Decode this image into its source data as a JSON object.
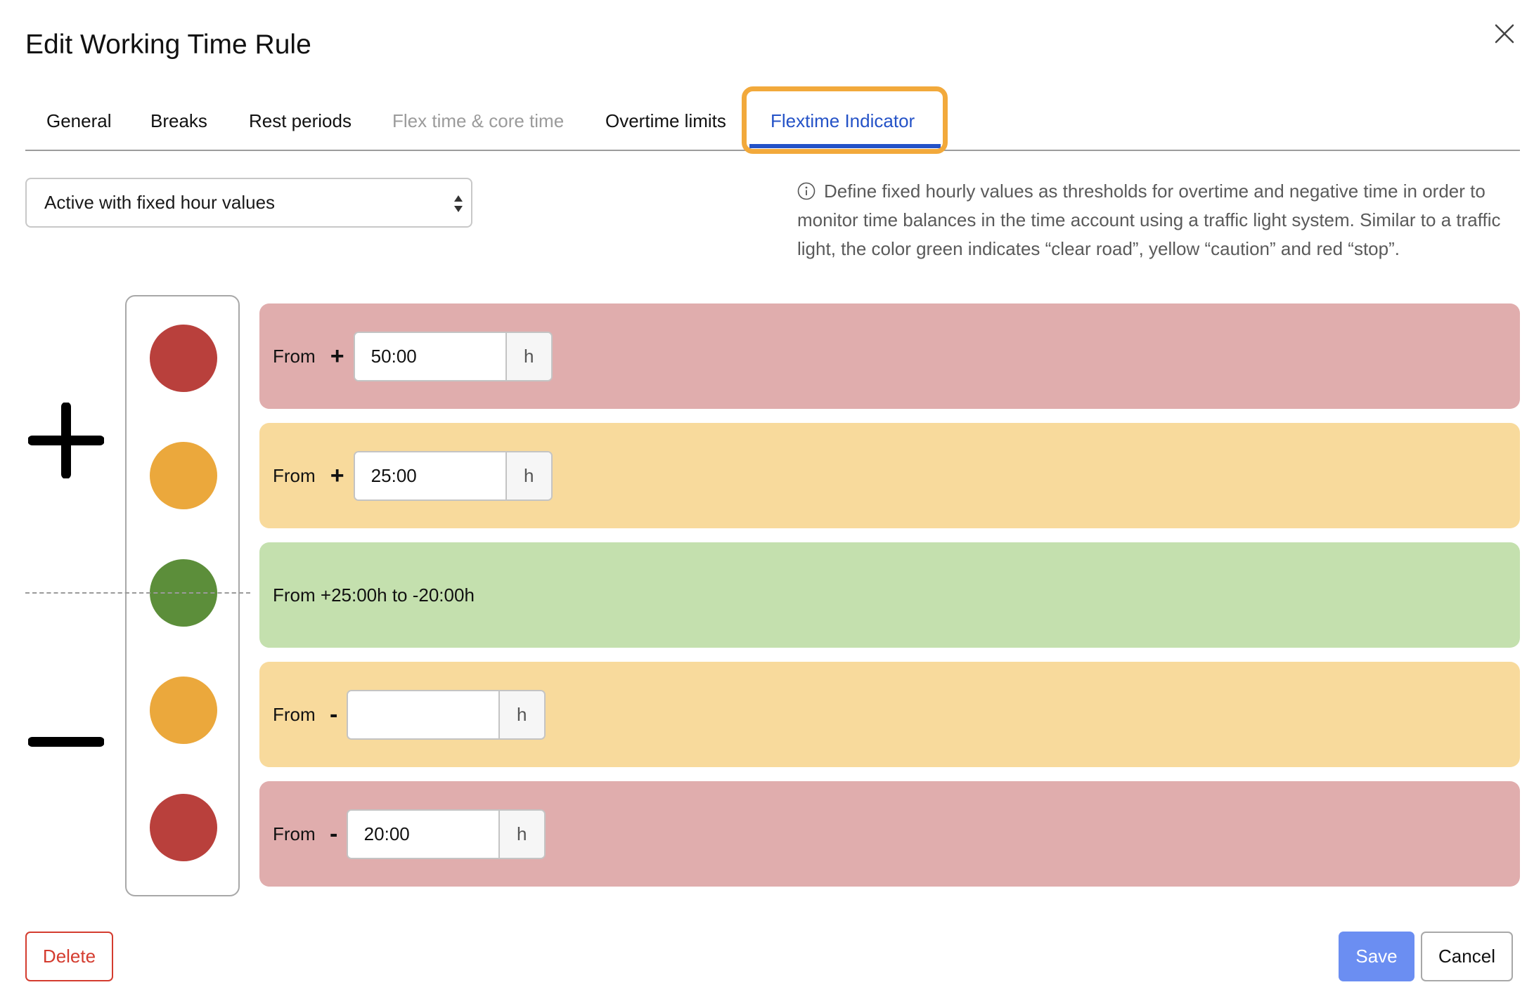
{
  "dialog": {
    "title": "Edit Working Time Rule",
    "close_icon": "close-icon"
  },
  "tabs": [
    {
      "label": "General",
      "state": "normal"
    },
    {
      "label": "Breaks",
      "state": "normal"
    },
    {
      "label": "Rest periods",
      "state": "normal"
    },
    {
      "label": "Flex time & core time",
      "state": "disabled"
    },
    {
      "label": "Overtime limits",
      "state": "normal"
    },
    {
      "label": "Flextime Indicator",
      "state": "active"
    }
  ],
  "mode_select": {
    "value": "Active with fixed hour values",
    "icon": "select-arrows-icon"
  },
  "info": {
    "icon": "info-icon",
    "text": "Define fixed hourly values as thresholds for overtime and negative time in order to monitor time balances in the time account using a traffic light system. Similar to a traffic light, the color green indicates “clear road”, yellow “caution” and red “stop”."
  },
  "signs": {
    "plus_icon": "plus-icon",
    "minus_icon": "minus-icon"
  },
  "traffic_lights": [
    "red",
    "yellow",
    "green",
    "yellow",
    "red"
  ],
  "bands": [
    {
      "color": "red",
      "from_label": "From",
      "sign": "+",
      "value": "50:00",
      "placeholder": "",
      "unit": "h"
    },
    {
      "color": "yellow",
      "from_label": "From",
      "sign": "+",
      "value": "25:00",
      "placeholder": "",
      "unit": "h"
    },
    {
      "color": "green",
      "text": "From +25:00h to -20:00h"
    },
    {
      "color": "yellow",
      "from_label": "From",
      "sign": "-",
      "value": "",
      "placeholder": "",
      "unit": "h"
    },
    {
      "color": "red",
      "from_label": "From",
      "sign": "-",
      "value": "20:00",
      "placeholder": "",
      "unit": "h"
    }
  ],
  "footer": {
    "delete_label": "Delete",
    "save_label": "Save",
    "cancel_label": "Cancel"
  },
  "colors": {
    "accent": "#2452c7",
    "highlight": "#f2a93b",
    "red_light": "#b9403c",
    "yellow_light": "#eba83c",
    "green_light": "#5c8e3a",
    "red_band": "#e0adad",
    "yellow_band": "#f8da9c",
    "green_band": "#c4e0ae",
    "delete": "#d43c2f",
    "save": "#6b8ef2"
  }
}
